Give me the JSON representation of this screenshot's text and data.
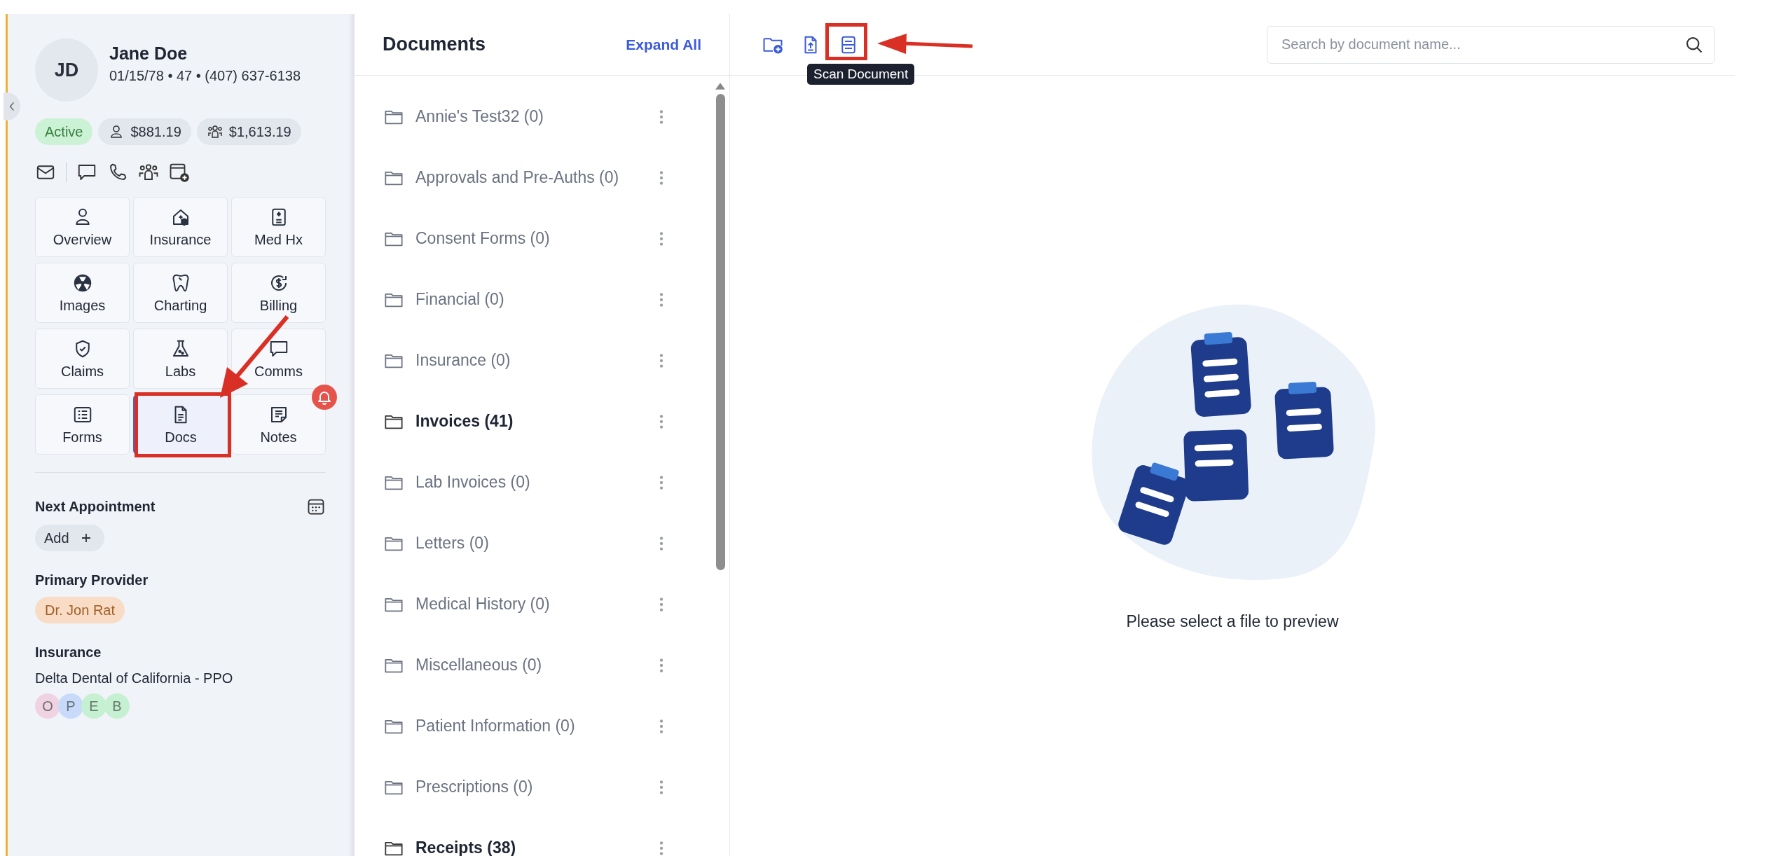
{
  "patient": {
    "initials": "JD",
    "name": "Jane Doe",
    "details": "01/15/78 • 47 • (407) 637-6138",
    "status": "Active",
    "balances": [
      {
        "kind": "patient",
        "amount": "$881.19"
      },
      {
        "kind": "family",
        "amount": "$1,613.19"
      }
    ]
  },
  "contact_actions": [
    {
      "kind": "mail"
    },
    {
      "kind": "chat"
    },
    {
      "kind": "phone"
    },
    {
      "kind": "group"
    },
    {
      "kind": "calendar-add"
    }
  ],
  "nav_tiles": [
    {
      "label": "Overview",
      "kind": "person",
      "selected": false,
      "alert": false
    },
    {
      "label": "Insurance",
      "kind": "insurance",
      "selected": false,
      "alert": false
    },
    {
      "label": "Med Hx",
      "kind": "medhx",
      "selected": false,
      "alert": false
    },
    {
      "label": "Images",
      "kind": "images",
      "selected": false,
      "alert": false
    },
    {
      "label": "Charting",
      "kind": "tooth",
      "selected": false,
      "alert": false
    },
    {
      "label": "Billing",
      "kind": "billing",
      "selected": false,
      "alert": false
    },
    {
      "label": "Claims",
      "kind": "claims",
      "selected": false,
      "alert": false
    },
    {
      "label": "Labs",
      "kind": "labs",
      "selected": false,
      "alert": false
    },
    {
      "label": "Comms",
      "kind": "chat",
      "selected": false,
      "alert": false
    },
    {
      "label": "Forms",
      "kind": "forms",
      "selected": false,
      "alert": false
    },
    {
      "label": "Docs",
      "kind": "doc",
      "selected": true,
      "alert": false
    },
    {
      "label": "Notes",
      "kind": "notes",
      "selected": false,
      "alert": true
    }
  ],
  "next_appointment": {
    "title": "Next Appointment",
    "add_label": "Add"
  },
  "primary_provider": {
    "title": "Primary Provider",
    "name": "Dr. Jon Rat"
  },
  "insurance": {
    "title": "Insurance",
    "plan": "Delta Dental of California - PPO",
    "badges": [
      {
        "letter": "O",
        "color": "#f0d3e2"
      },
      {
        "letter": "P",
        "color": "#c7dafa"
      },
      {
        "letter": "E",
        "color": "#c6f0d2"
      },
      {
        "letter": "B",
        "color": "#c6f0d2"
      }
    ]
  },
  "documents": {
    "title": "Documents",
    "expand_label": "Expand All",
    "folders": [
      {
        "name": "Annie's Test32 (0)",
        "bold": false
      },
      {
        "name": "Approvals and Pre-Auths (0)",
        "bold": false
      },
      {
        "name": "Consent Forms (0)",
        "bold": false
      },
      {
        "name": "Financial (0)",
        "bold": false
      },
      {
        "name": "Insurance (0)",
        "bold": false
      },
      {
        "name": "Invoices (41)",
        "bold": true
      },
      {
        "name": "Lab Invoices (0)",
        "bold": false
      },
      {
        "name": "Letters (0)",
        "bold": false
      },
      {
        "name": "Medical History (0)",
        "bold": false
      },
      {
        "name": "Miscellaneous (0)",
        "bold": false
      },
      {
        "name": "Patient Information (0)",
        "bold": false
      },
      {
        "name": "Prescriptions (0)",
        "bold": false
      },
      {
        "name": "Receipts (38)",
        "bold": true
      }
    ]
  },
  "toolbar": {
    "buttons": [
      {
        "kind": "new-folder"
      },
      {
        "kind": "upload"
      },
      {
        "kind": "scan",
        "tooltip": "Scan Document"
      }
    ],
    "search_placeholder": "Search by document name..."
  },
  "preview": {
    "message": "Please select a file to preview"
  }
}
